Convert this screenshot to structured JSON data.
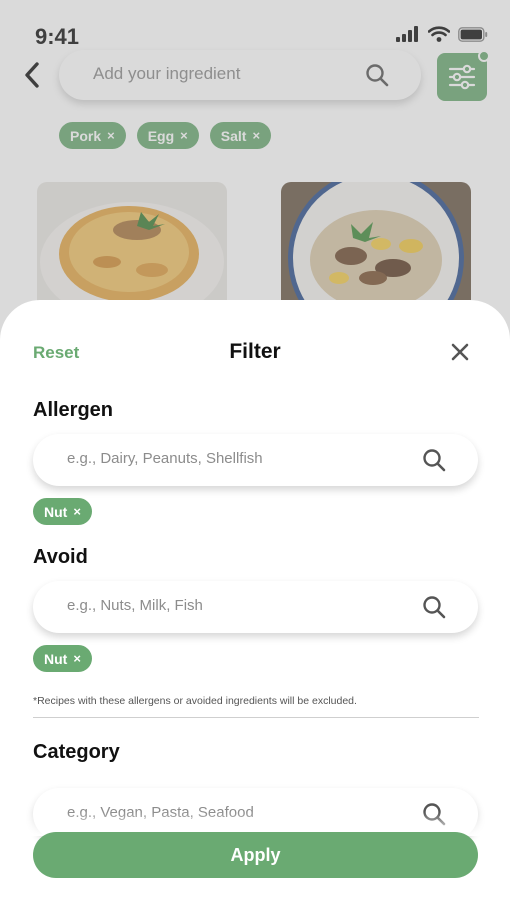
{
  "status": {
    "time": "9:41"
  },
  "search": {
    "placeholder": "Add your ingredient"
  },
  "ingredients": [
    {
      "label": "Pork",
      "remove": "×"
    },
    {
      "label": "Egg",
      "remove": "×"
    },
    {
      "label": "Salt",
      "remove": "×"
    }
  ],
  "colors": {
    "accent": "#6aaa72",
    "text": "#111111"
  },
  "icons": [
    "back-icon",
    "search-icon",
    "filter-sliders-icon",
    "close-icon",
    "signal-icon",
    "wifi-icon",
    "battery-icon"
  ],
  "filter": {
    "reset_label": "Reset",
    "title": "Filter",
    "allergen": {
      "heading": "Allergen",
      "placeholder": "e.g., Dairy, Peanuts, Shellfish",
      "chips": [
        {
          "label": "Nut",
          "remove": "×"
        }
      ]
    },
    "avoid": {
      "heading": "Avoid",
      "placeholder": "e.g., Nuts, Milk, Fish",
      "chips": [
        {
          "label": "Nut",
          "remove": "×"
        }
      ]
    },
    "note": "*Recipes with these allergens or avoided ingredients will be excluded.",
    "category": {
      "heading": "Category",
      "placeholder": "e.g., Vegan, Pasta, Seafood"
    },
    "apply_label": "Apply"
  }
}
